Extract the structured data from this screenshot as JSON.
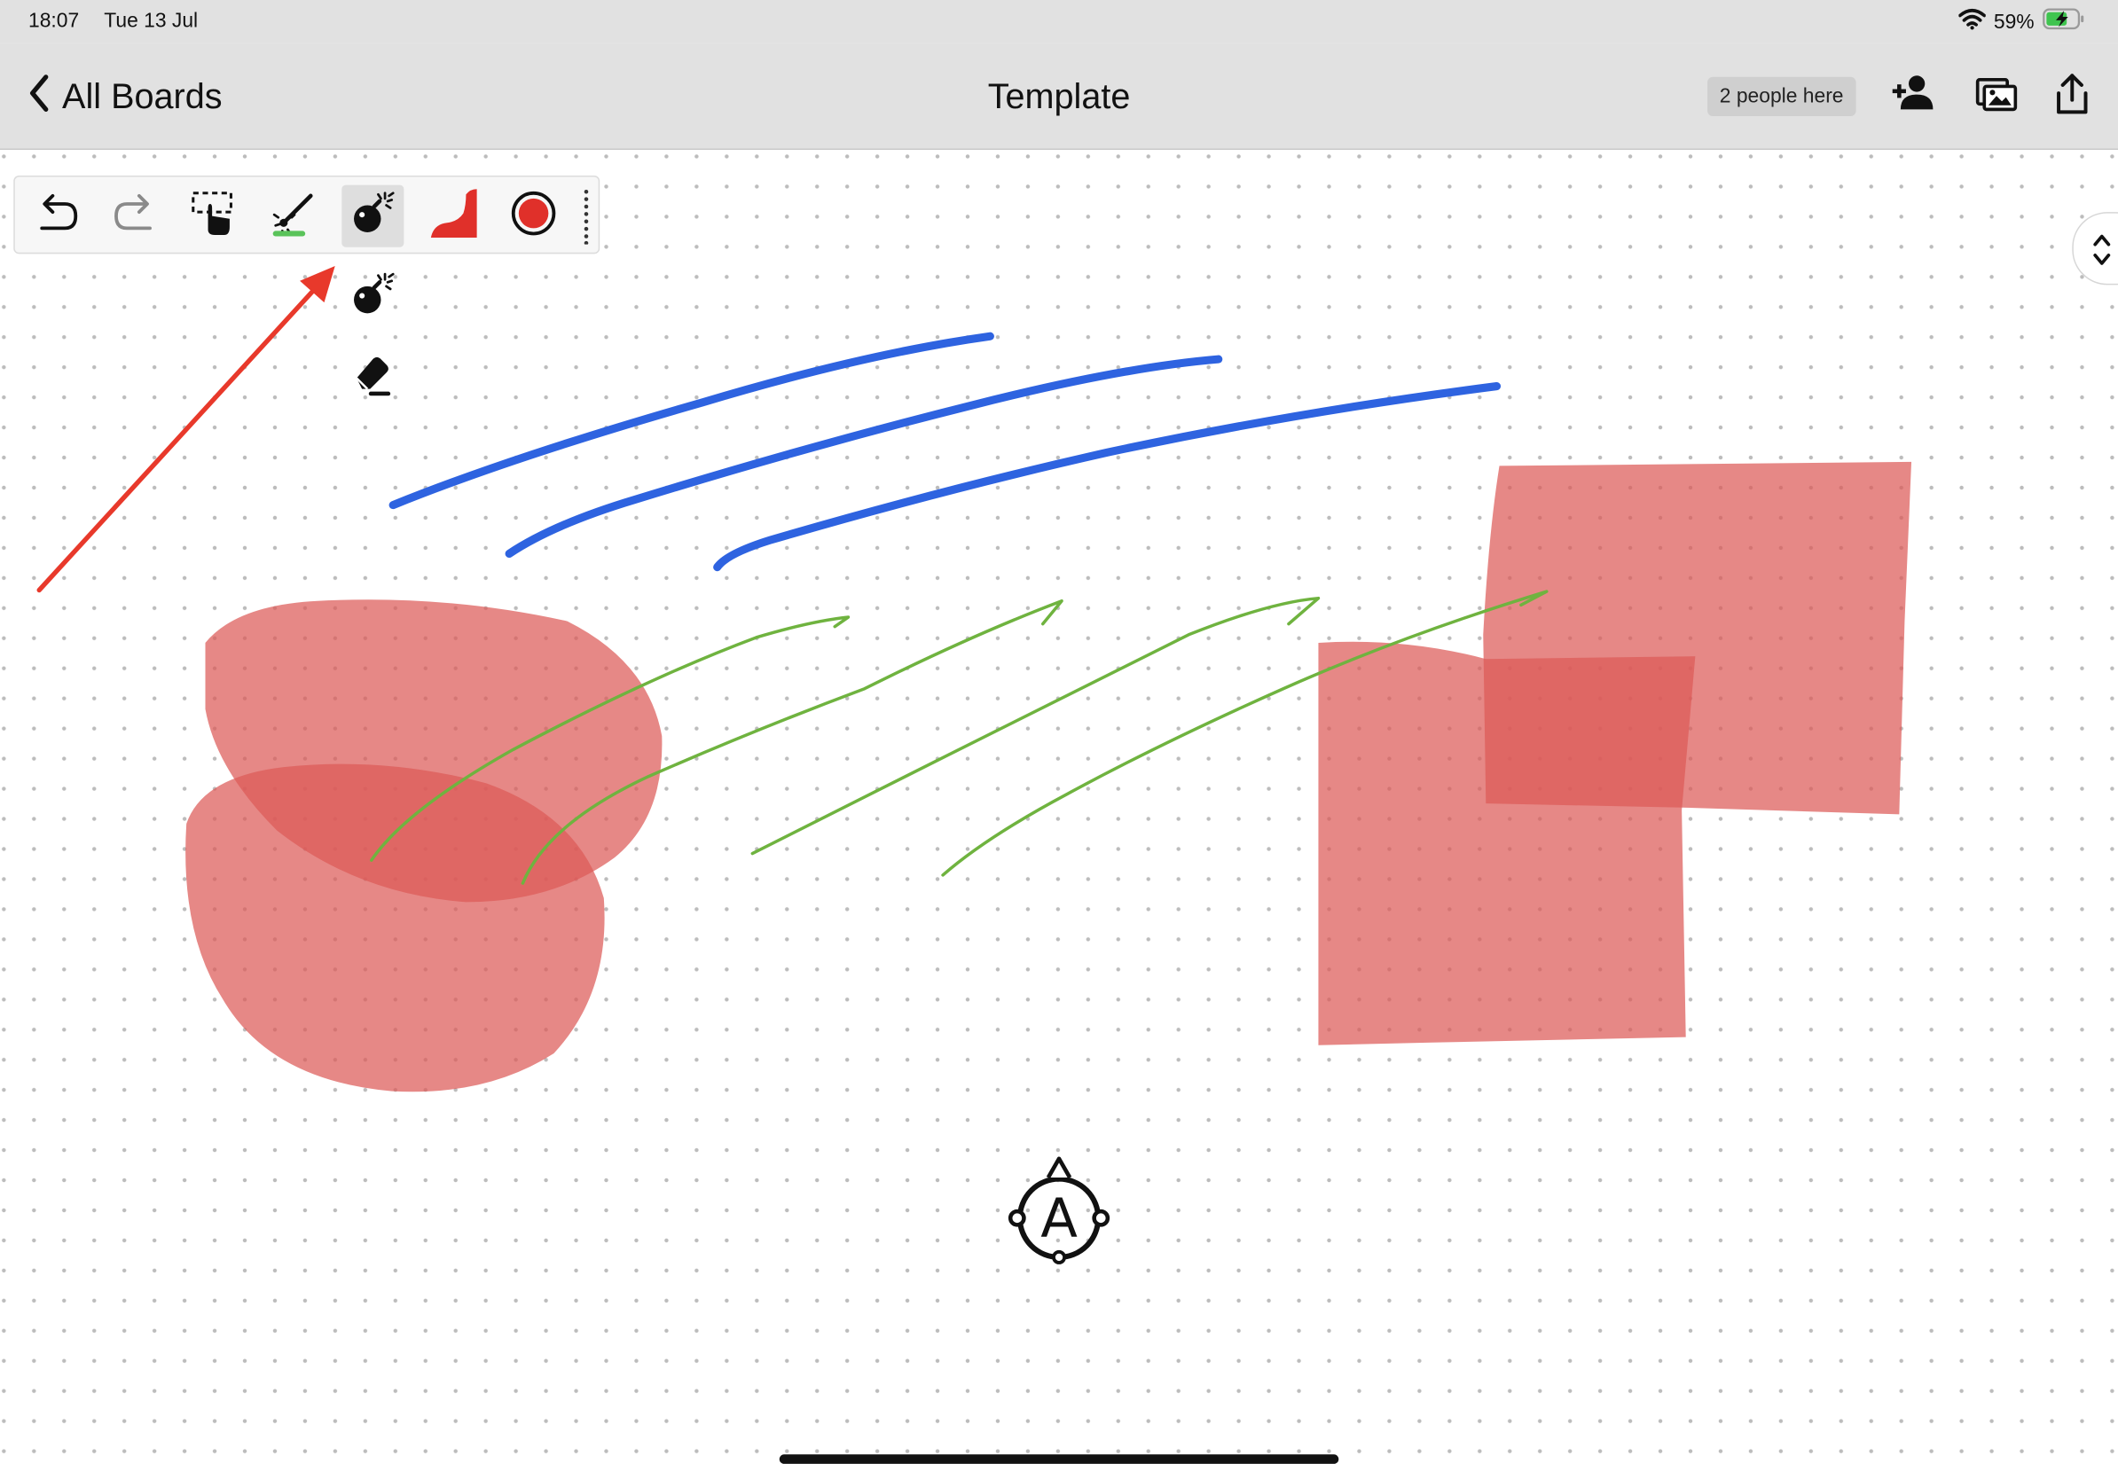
{
  "status_bar": {
    "time": "18:07",
    "date": "Tue 13 Jul",
    "battery": "59%",
    "icons": [
      "wifi-icon",
      "battery-charging-icon"
    ]
  },
  "nav": {
    "back_label": "All Boards",
    "title": "Template",
    "people_badge": "2 people here",
    "icons": [
      "add-person-icon",
      "gallery-icon",
      "share-icon"
    ]
  },
  "toolbar": {
    "tools": [
      "undo-icon",
      "redo-icon",
      "select-icon",
      "laser-pointer-icon",
      "bomb-icon",
      "shape-fill-icon",
      "color-icon"
    ],
    "active_tool": "bomb",
    "active_color": "#e0302a",
    "laser_color": "#5ac35a"
  },
  "tool_popup": {
    "items": [
      "bomb-icon",
      "eraser-icon"
    ]
  },
  "canvas": {
    "background": "dot-grid",
    "stroke_colors": {
      "blue": "#2e63e0",
      "green": "#6fb33f",
      "red_fill": "#dd5a58",
      "red_arrow": "#e8392b"
    },
    "center_badge_letter": "A"
  }
}
